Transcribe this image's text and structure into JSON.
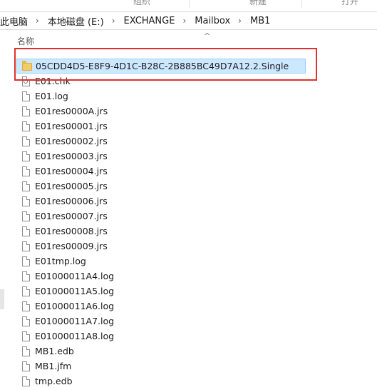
{
  "ribbon": {
    "group1": "组织",
    "group2": "新建",
    "group3": "打开"
  },
  "breadcrumb": {
    "items": [
      "此电脑",
      "本地磁盘 (E:)",
      "EXCHANGE",
      "Mailbox",
      "MB1"
    ]
  },
  "list": {
    "column_name": "名称",
    "sort_indicator": "^",
    "files": [
      {
        "name": "05CDD4D5-E8F9-4D1C-B28C-2B885BC49D7A12.2.Single",
        "type": "folder"
      },
      {
        "name": "E01.chk",
        "type": "chk"
      },
      {
        "name": "E01.log",
        "type": "file"
      },
      {
        "name": "E01res0000A.jrs",
        "type": "file"
      },
      {
        "name": "E01res00001.jrs",
        "type": "file"
      },
      {
        "name": "E01res00002.jrs",
        "type": "file"
      },
      {
        "name": "E01res00003.jrs",
        "type": "file"
      },
      {
        "name": "E01res00004.jrs",
        "type": "file"
      },
      {
        "name": "E01res00005.jrs",
        "type": "file"
      },
      {
        "name": "E01res00006.jrs",
        "type": "file"
      },
      {
        "name": "E01res00007.jrs",
        "type": "file"
      },
      {
        "name": "E01res00008.jrs",
        "type": "file"
      },
      {
        "name": "E01res00009.jrs",
        "type": "file"
      },
      {
        "name": "E01tmp.log",
        "type": "file"
      },
      {
        "name": "E01000011A4.log",
        "type": "file"
      },
      {
        "name": "E01000011A5.log",
        "type": "file"
      },
      {
        "name": "E01000011A6.log",
        "type": "file"
      },
      {
        "name": "E01000011A7.log",
        "type": "file"
      },
      {
        "name": "E01000011A8.log",
        "type": "file"
      },
      {
        "name": "MB1.edb",
        "type": "file"
      },
      {
        "name": "MB1.jfm",
        "type": "file"
      },
      {
        "name": "tmp.edb",
        "type": "file"
      }
    ]
  },
  "colors": {
    "selection_bg": "#cce8ff",
    "selection_border": "#99d1ff",
    "highlight_box": "#e03030",
    "folder": "#f2cc6b"
  }
}
